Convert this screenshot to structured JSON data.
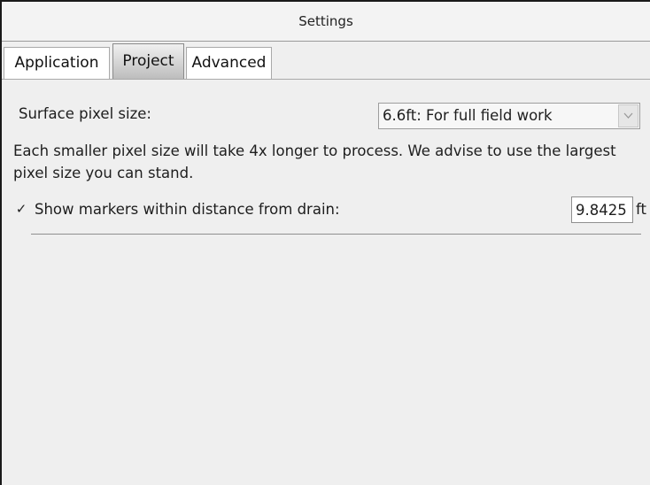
{
  "window": {
    "title": "Settings"
  },
  "tabs": [
    {
      "label": "Application",
      "active": false
    },
    {
      "label": "Project",
      "active": true
    },
    {
      "label": "Advanced",
      "active": false
    }
  ],
  "project": {
    "surface_pixel_size": {
      "label": "Surface pixel size:",
      "selected": "6.6ft: For full field work"
    },
    "info_text": "Each smaller pixel size will take 4x longer to process. We advise to use the largest pixel size you can stand.",
    "show_markers": {
      "checked": true,
      "checkbox_glyph": "✓",
      "label": "Show markers within distance from drain:",
      "value": "9.8425",
      "unit": "ft"
    }
  },
  "icons": {
    "dropdown_arrow": "chevron-down-icon"
  },
  "colors": {
    "window_background": "#efefef",
    "active_tab_gradient_bottom": "#bdbdbd",
    "border": "#a9a9a9"
  }
}
